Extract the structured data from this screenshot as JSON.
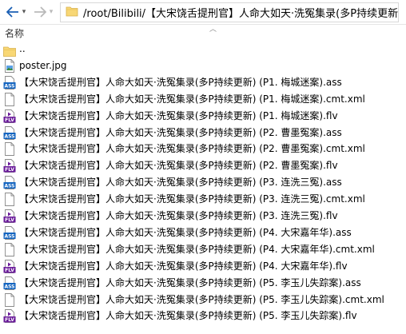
{
  "toolbar": {
    "back_icon": "arrow-left",
    "forward_icon": "arrow-right",
    "dropdown_icon": "chevron-down"
  },
  "address": {
    "path": "/root/Bilibili/【大宋饶舌提刑官】人命大如天·洗冤集录(多P持续更新)"
  },
  "header": {
    "name_label": "名称",
    "sort_icon": "chevron-up"
  },
  "files": [
    {
      "name": "..",
      "type": "folder"
    },
    {
      "name": "poster.jpg",
      "type": "image"
    },
    {
      "name": "【大宋饶舌提刑官】人命大如天·洗冤集录(多P持续更新) (P1. 梅城迷案).ass",
      "type": "ass"
    },
    {
      "name": "【大宋饶舌提刑官】人命大如天·洗冤集录(多P持续更新) (P1. 梅城迷案).cmt.xml",
      "type": "doc"
    },
    {
      "name": "【大宋饶舌提刑官】人命大如天·洗冤集录(多P持续更新) (P1. 梅城迷案).flv",
      "type": "flv"
    },
    {
      "name": "【大宋饶舌提刑官】人命大如天·洗冤集录(多P持续更新) (P2. 曹墨冤案).ass",
      "type": "ass"
    },
    {
      "name": "【大宋饶舌提刑官】人命大如天·洗冤集录(多P持续更新) (P2. 曹墨冤案).cmt.xml",
      "type": "doc"
    },
    {
      "name": "【大宋饶舌提刑官】人命大如天·洗冤集录(多P持续更新) (P2. 曹墨冤案).flv",
      "type": "flv"
    },
    {
      "name": "【大宋饶舌提刑官】人命大如天·洗冤集录(多P持续更新) (P3. 连洗三冤).ass",
      "type": "ass"
    },
    {
      "name": "【大宋饶舌提刑官】人命大如天·洗冤集录(多P持续更新) (P3. 连洗三冤).cmt.xml",
      "type": "doc"
    },
    {
      "name": "【大宋饶舌提刑官】人命大如天·洗冤集录(多P持续更新) (P3. 连洗三冤).flv",
      "type": "flv"
    },
    {
      "name": "【大宋饶舌提刑官】人命大如天·洗冤集录(多P持续更新) (P4. 大宋嘉年华).ass",
      "type": "ass"
    },
    {
      "name": "【大宋饶舌提刑官】人命大如天·洗冤集录(多P持续更新) (P4. 大宋嘉年华).cmt.xml",
      "type": "doc"
    },
    {
      "name": "【大宋饶舌提刑官】人命大如天·洗冤集录(多P持续更新) (P4. 大宋嘉年华).flv",
      "type": "flv"
    },
    {
      "name": "【大宋饶舌提刑官】人命大如天·洗冤集录(多P持续更新) (P5. 李玉儿失踪案).ass",
      "type": "ass"
    },
    {
      "name": "【大宋饶舌提刑官】人命大如天·洗冤集录(多P持续更新) (P5. 李玉儿失踪案).cmt.xml",
      "type": "doc"
    },
    {
      "name": "【大宋饶舌提刑官】人命大如天·洗冤集录(多P持续更新) (P5. 李玉儿失踪案).flv",
      "type": "flv"
    }
  ],
  "colors": {
    "folder": "#f8d775",
    "ass_badge": "#1565c0",
    "flv_badge": "#6a1b9a",
    "back_arrow": "#1a5fb4"
  }
}
